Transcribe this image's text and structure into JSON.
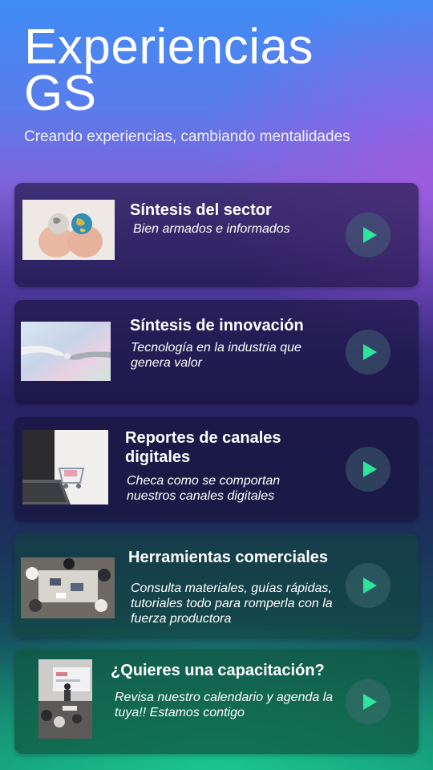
{
  "hero": {
    "title_line1": "Experiencias",
    "title_line2": "GS",
    "subtitle": "Creando experiencias, cambiando mentalidades"
  },
  "cards": [
    {
      "title": "Síntesis del sector",
      "description": "Bien armados e informados",
      "icon": "play-icon"
    },
    {
      "title": "Síntesis de innovación",
      "description": "Tecnología en la industria que genera valor",
      "icon": "play-icon"
    },
    {
      "title": "Reportes de canales digitales",
      "description": "Checa como se comportan nuestros canales digitales",
      "icon": "play-icon"
    },
    {
      "title": "Herramientas comerciales",
      "description": "Consulta materiales, guías rápidas, tutoriales todo para romperla con la fuerza productora",
      "icon": "play-icon"
    },
    {
      "title": "¿Quieres una capacitación?",
      "description": "Revisa nuestro calendario y agenda la tuya!! Estamos contigo",
      "icon": "play-icon"
    }
  ],
  "colors": {
    "play_accent": "#2ee59d",
    "text": "#ffffff"
  }
}
